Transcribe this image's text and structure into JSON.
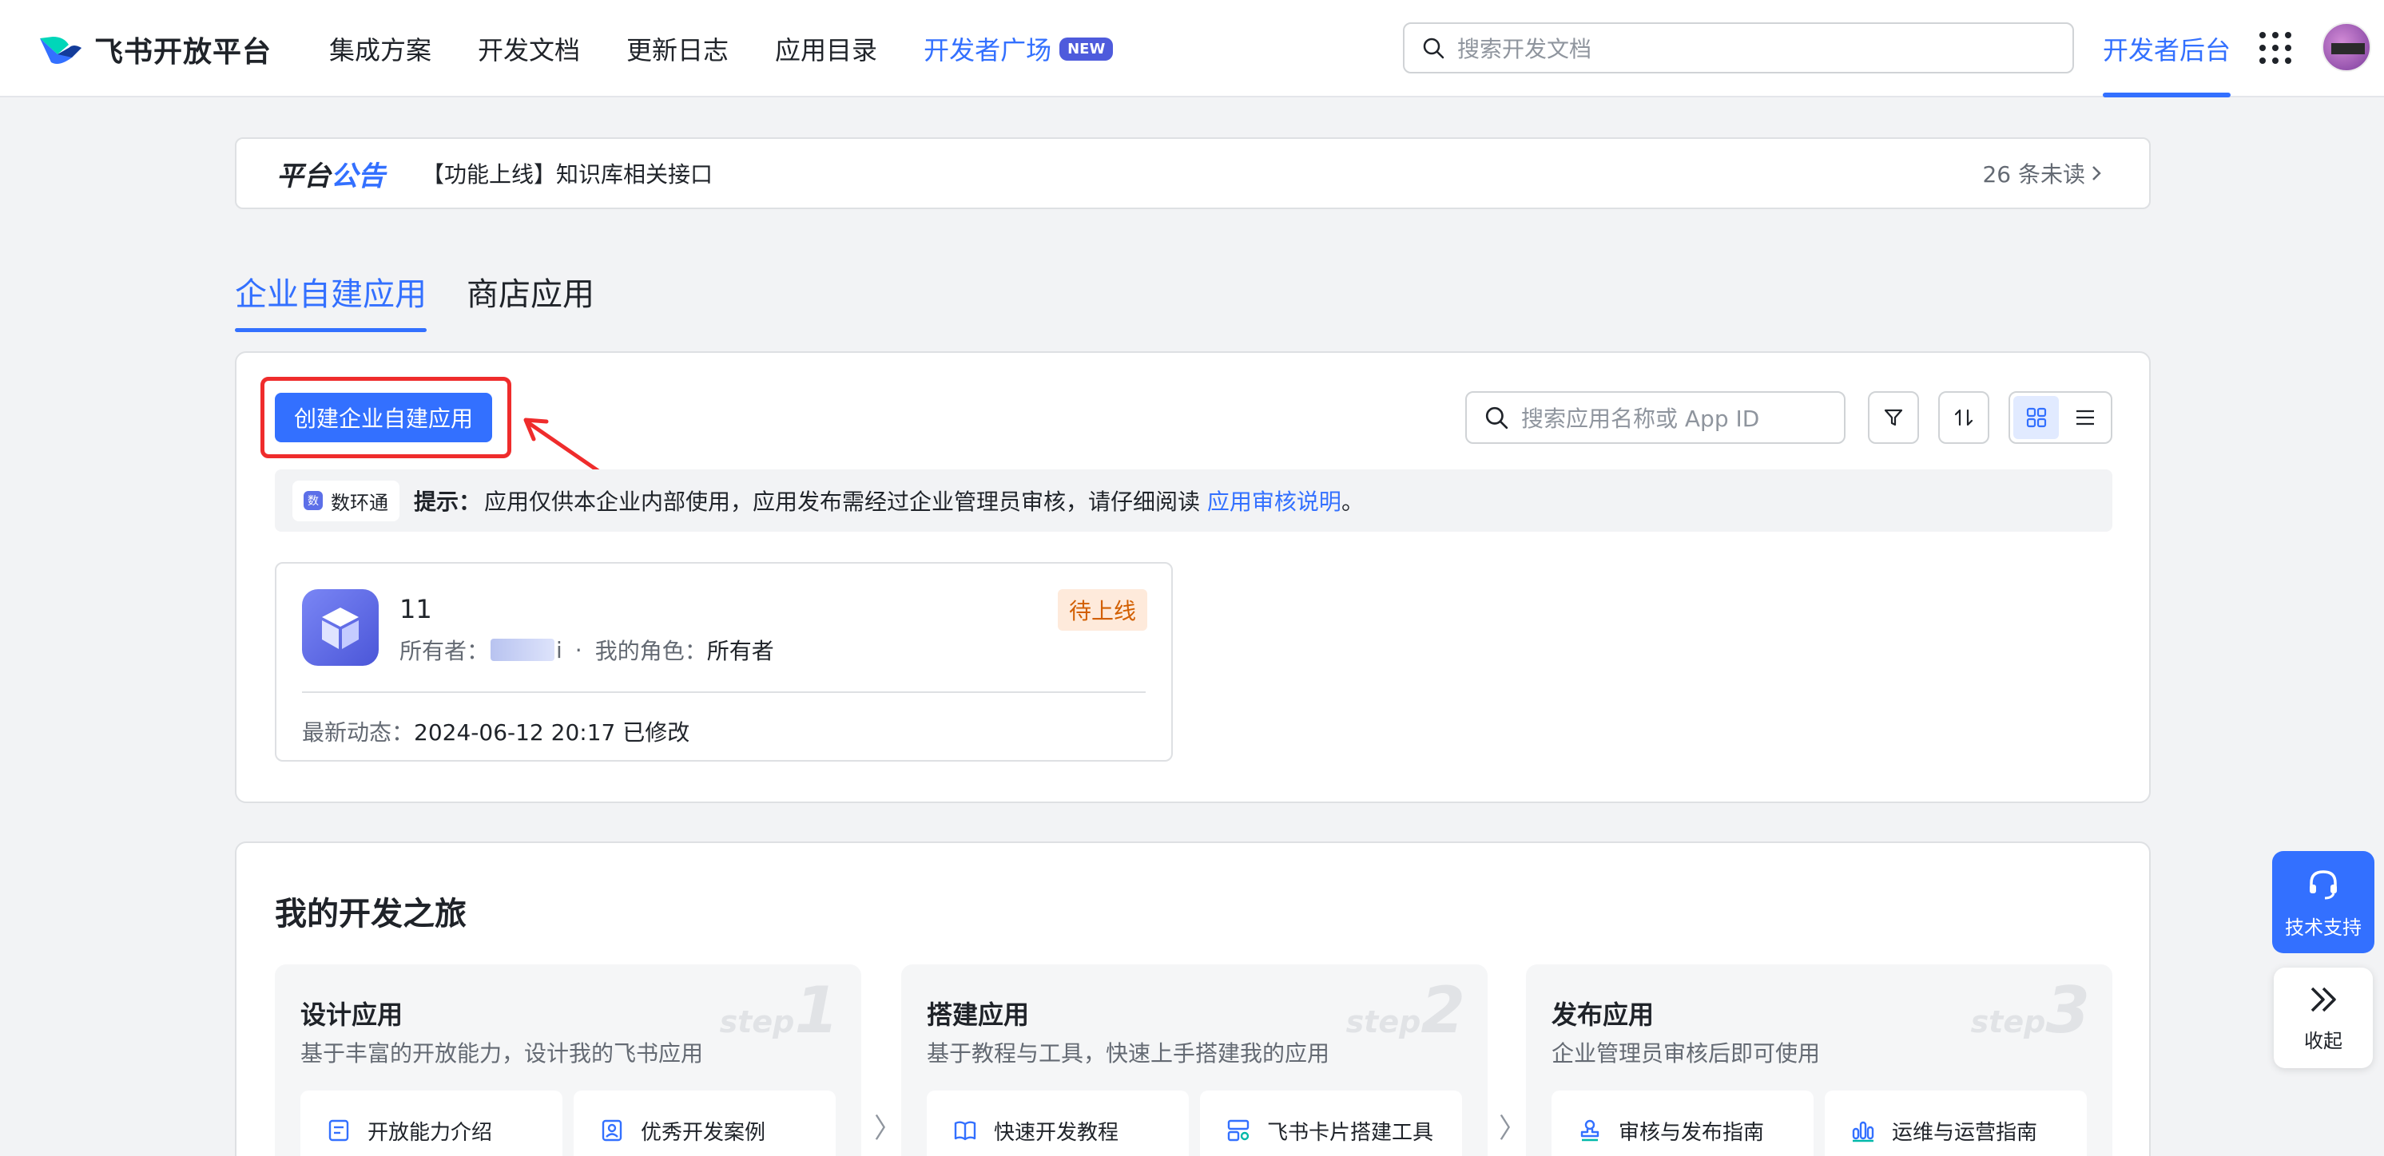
{
  "header": {
    "logo_text": "飞书开放平台",
    "nav": [
      {
        "label": "集成方案"
      },
      {
        "label": "开发文档"
      },
      {
        "label": "更新日志"
      },
      {
        "label": "应用目录"
      },
      {
        "label": "开发者广场",
        "badge": "NEW"
      }
    ],
    "search_placeholder": "搜索开发文档",
    "dev_console": "开发者后台"
  },
  "announcement": {
    "title_a": "平台",
    "title_b": "公告",
    "text": "【功能上线】知识库相关接口",
    "unread": "26 条未读"
  },
  "tabs": [
    {
      "label": "企业自建应用",
      "active": true
    },
    {
      "label": "商店应用",
      "active": false
    }
  ],
  "panel": {
    "create_button": "创建企业自建应用",
    "search_placeholder": "搜索应用名称或 App ID",
    "tip": {
      "chip": "数环通",
      "label": "提示：",
      "text": "应用仅供本企业内部使用，应用发布需经过企业管理员审核，请仔细阅读 ",
      "link": "应用审核说明",
      "end": "。"
    },
    "app": {
      "name": "11",
      "status": "待上线",
      "owner_label": "所有者：",
      "owner_suffix": "i",
      "sep": "·",
      "role_label": "我的角色：",
      "role": "所有者",
      "update_label": "最新动态：",
      "update": "2024-06-12 20:17 已修改"
    }
  },
  "journey": {
    "title": "我的开发之旅",
    "steps": [
      {
        "title": "设计应用",
        "desc": "基于丰富的开放能力，设计我的飞书应用",
        "step_word": "step",
        "step_num": "1",
        "links": [
          {
            "label": "开放能力介绍"
          },
          {
            "label": "优秀开发案例"
          }
        ]
      },
      {
        "title": "搭建应用",
        "desc": "基于教程与工具，快速上手搭建我的应用",
        "step_word": "step",
        "step_num": "2",
        "links": [
          {
            "label": "快速开发教程"
          },
          {
            "label": "飞书卡片搭建工具"
          }
        ]
      },
      {
        "title": "发布应用",
        "desc": "企业管理员审核后即可使用",
        "step_word": "step",
        "step_num": "3",
        "links": [
          {
            "label": "审核与发布指南"
          },
          {
            "label": "运维与运营指南"
          }
        ]
      }
    ],
    "chevron": "〉"
  },
  "floating": {
    "support": "技术支持",
    "collapse": "收起"
  },
  "colors": {
    "accent": "#3370ff",
    "highlight": "#ef2c2c",
    "status_bg": "#feeadb",
    "status_fg": "#d25f00"
  }
}
